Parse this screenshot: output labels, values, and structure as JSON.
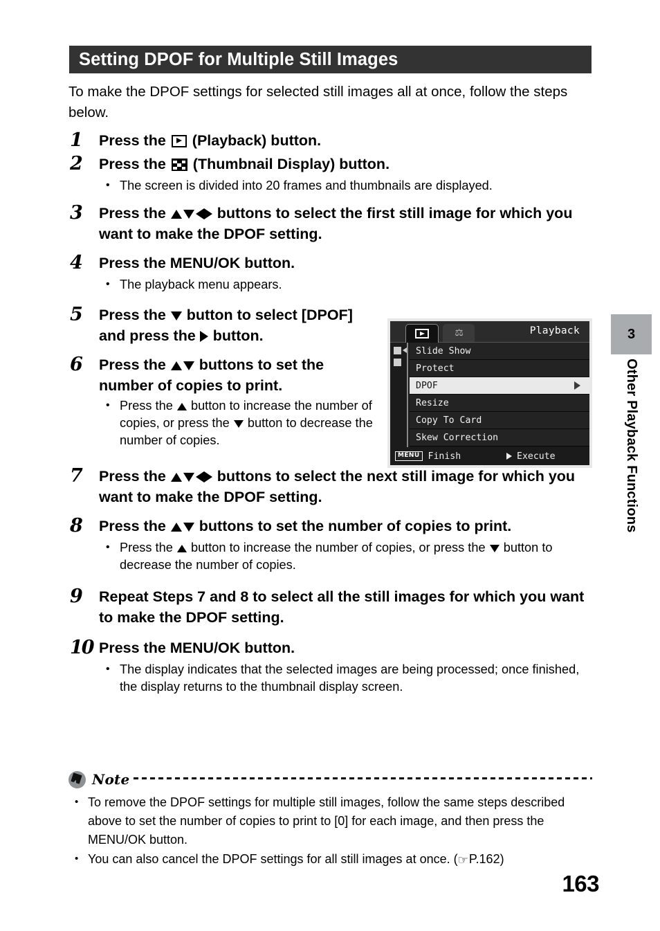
{
  "document": {
    "page_number": "163",
    "section_title": "Setting DPOF for Multiple Still Images",
    "intro": "To make the DPOF settings for selected still images all at once, follow the steps below."
  },
  "side_tab": {
    "chapter_number": "3",
    "chapter_title": "Other Playback Functions"
  },
  "steps": [
    {
      "number": "1",
      "text_before": "Press the",
      "icon": "playback-button-icon",
      "text_after": "(Playback) button.",
      "bullets": []
    },
    {
      "number": "2",
      "text_before": "Press the",
      "icon": "thumbnail-display-icon",
      "text_after": "(Thumbnail Display) button.",
      "bullets": [
        "The screen is divided into 20 frames and thumbnails are displayed."
      ]
    },
    {
      "number": "3",
      "text_before": "Press the",
      "icon": "up-down-left-right-arrows-icon",
      "text_after": "buttons to select the first still image for which you want to make the DPOF setting.",
      "bullets": []
    },
    {
      "number": "4",
      "text_before": "Press the MENU/OK button.",
      "icon": "",
      "text_after": "",
      "bullets": [
        "The playback menu appears."
      ]
    },
    {
      "number": "5",
      "text_before": "Press the",
      "icon": "down-arrow-icon",
      "text_mid": "button to select [DPOF] and press the",
      "icon2": "right-arrow-icon",
      "text_after": "button.",
      "bullets": []
    },
    {
      "number": "6",
      "text_before": "Press the",
      "icon": "up-down-arrows-icon",
      "text_after": "buttons to set the number of copies to print.",
      "bullets_rich": [
        {
          "a": "Press the",
          "icon_a": "up-arrow-icon",
          "b": "button to increase the number of copies, or press the",
          "icon_b": "down-arrow-icon",
          "c": "button to decrease the number of copies."
        }
      ]
    },
    {
      "number": "7",
      "text_before": "Press the",
      "icon": "up-down-left-right-arrows-icon",
      "text_after": "buttons to select the next still image for which you want to make the DPOF setting.",
      "bullets": []
    },
    {
      "number": "8",
      "text_before": "Press the",
      "icon": "up-down-arrows-icon",
      "text_after": "buttons to set the number of copies to print.",
      "bullets_rich": [
        {
          "a": "Press the",
          "icon_a": "up-arrow-icon",
          "b": "button to increase the number of copies, or press the",
          "icon_b": "down-arrow-icon",
          "c": "button to decrease the number of copies."
        }
      ]
    },
    {
      "number": "9",
      "text_before": "Repeat Steps 7 and 8 to select all the still images for which you want to make the DPOF setting.",
      "icon": "",
      "text_after": "",
      "bullets": []
    },
    {
      "number": "10",
      "text_before": "Press the MENU/OK button.",
      "icon": "",
      "text_after": "",
      "bullets": [
        "The display indicates that the selected images are being processed; once finished, the display returns to the thumbnail display screen."
      ]
    }
  ],
  "lcd_screen": {
    "tabs": [
      {
        "name": "playback-tab",
        "icon": "play-icon",
        "active": true
      },
      {
        "name": "setup-tab",
        "icon": "tools-icon",
        "active": false
      }
    ],
    "mode_label": "Playback",
    "menu_items": [
      {
        "label": "Slide Show",
        "selected": false,
        "has_submenu": false
      },
      {
        "label": "Protect",
        "selected": false,
        "has_submenu": false
      },
      {
        "label": "DPOF",
        "selected": true,
        "has_submenu": true
      },
      {
        "label": "Resize",
        "selected": false,
        "has_submenu": false
      },
      {
        "label": "Copy To Card",
        "selected": false,
        "has_submenu": false
      },
      {
        "label": "Skew Correction",
        "selected": false,
        "has_submenu": false
      }
    ],
    "footer": {
      "menu_chip": "MENU",
      "finish_label": "Finish",
      "execute_label": "Execute"
    }
  },
  "note": {
    "label": "Note",
    "bullets": [
      "To remove the DPOF settings for multiple still images, follow the same steps described above to set the number of copies to print to [0] for each image, and then press the MENU/OK button.",
      "You can also cancel the DPOF settings for all still images at once. ("
    ],
    "reference_page": "P.162",
    "reference_close": ")"
  }
}
